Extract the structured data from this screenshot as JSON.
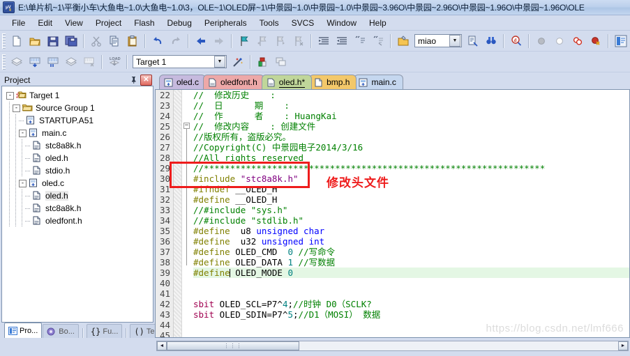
{
  "window": {
    "title": "E:\\单片机~1\\平衡小车\\大鱼电~1.0\\大鱼电~1.0\\3，OLE~1\\OLED屏~1\\中景园~1.0\\中景园~1.0\\中景园~3.96O\\中景园~2.96O\\中景园~1.96O\\中景园~1.96O\\OLE",
    "icon": "keil-uvision-icon"
  },
  "menu": {
    "items": [
      "File",
      "Edit",
      "View",
      "Project",
      "Flash",
      "Debug",
      "Peripherals",
      "Tools",
      "SVCS",
      "Window",
      "Help"
    ]
  },
  "toolbar_main": {
    "buttons": [
      {
        "name": "new-file-button",
        "icon": "new-file-icon"
      },
      {
        "name": "open-file-button",
        "icon": "open-folder-icon"
      },
      {
        "name": "save-button",
        "icon": "floppy-disk-icon"
      },
      {
        "name": "save-all-button",
        "icon": "save-all-icon"
      },
      {
        "name": "cut-button",
        "icon": "scissors-icon"
      },
      {
        "name": "copy-button",
        "icon": "copy-icon"
      },
      {
        "name": "paste-button",
        "icon": "paste-icon"
      },
      {
        "name": "undo-button",
        "icon": "undo-arrow-icon"
      },
      {
        "name": "redo-button",
        "icon": "redo-arrow-icon"
      },
      {
        "name": "navigate-back-button",
        "icon": "left-arrow-icon"
      },
      {
        "name": "navigate-forward-button",
        "icon": "right-arrow-icon"
      },
      {
        "name": "toggle-bookmark-button",
        "icon": "bookmark-flag-icon"
      },
      {
        "name": "previous-bookmark-button",
        "icon": "bookmark-prev-icon"
      },
      {
        "name": "next-bookmark-button",
        "icon": "bookmark-next-icon"
      },
      {
        "name": "clear-bookmarks-button",
        "icon": "bookmark-clear-icon"
      },
      {
        "name": "indent-button",
        "icon": "indent-icon"
      },
      {
        "name": "outdent-button",
        "icon": "outdent-icon"
      },
      {
        "name": "comment-button",
        "icon": "comment-lines-icon"
      },
      {
        "name": "uncomment-button",
        "icon": "uncomment-lines-icon"
      },
      {
        "name": "open-file-dialog-button",
        "icon": "open-document-icon"
      }
    ],
    "search_box": {
      "value": "miao",
      "placeholder": "",
      "name": "find-combo"
    },
    "after_search_buttons": [
      {
        "name": "find-in-files-button",
        "icon": "find-in-files-icon"
      },
      {
        "name": "incremental-find-button",
        "icon": "binoculars-icon"
      },
      {
        "name": "browse-symbols-button",
        "icon": "magnifier-d-icon"
      },
      {
        "name": "insert-breakpoint-button",
        "icon": "gray-dot-icon"
      },
      {
        "name": "kill-all-breakpoints-button",
        "icon": "white-dot-icon"
      },
      {
        "name": "disable-breakpoint-button",
        "icon": "red-rings-icon"
      },
      {
        "name": "remove-breakpoint-button",
        "icon": "red-dot-x-icon"
      },
      {
        "name": "project-window-button",
        "icon": "project-window-icon"
      }
    ]
  },
  "toolbar_build": {
    "buttons": [
      {
        "name": "translate-button",
        "icon": "translate-icon"
      },
      {
        "name": "build-button",
        "icon": "build-icon"
      },
      {
        "name": "rebuild-all-button",
        "icon": "rebuild-icon"
      },
      {
        "name": "batch-build-button",
        "icon": "batch-build-icon"
      },
      {
        "name": "stop-build-button",
        "icon": "stop-build-icon"
      },
      {
        "name": "download-button",
        "icon": "load-download-icon"
      }
    ],
    "target_select": {
      "value": "Target 1",
      "name": "target-select"
    },
    "after_target_buttons": [
      {
        "name": "options-for-target-button",
        "icon": "magic-wand-icon"
      },
      {
        "name": "manage-project-items-button",
        "icon": "manage-components-icon"
      },
      {
        "name": "multi-project-button",
        "icon": "multi-project-icon"
      }
    ]
  },
  "project_panel": {
    "title": "Project",
    "pin_icon": "pin-icon",
    "close_icon": "close-icon",
    "tree": [
      {
        "label": "Target 1",
        "depth": 0,
        "expander": "-",
        "icon": "target-icon",
        "selected": false
      },
      {
        "label": "Source Group 1",
        "depth": 1,
        "expander": "-",
        "icon": "folder-icon",
        "selected": false
      },
      {
        "label": "STARTUP.A51",
        "depth": 2,
        "expander": "",
        "icon": "asm-file-icon",
        "selected": false
      },
      {
        "label": "main.c",
        "depth": 2,
        "expander": "-",
        "icon": "c-file-icon",
        "selected": false
      },
      {
        "label": "stc8a8k.h",
        "depth": 3,
        "expander": "",
        "icon": "header-file-icon",
        "selected": false
      },
      {
        "label": "oled.h",
        "depth": 3,
        "expander": "",
        "icon": "header-file-icon",
        "selected": false
      },
      {
        "label": "stdio.h",
        "depth": 3,
        "expander": "",
        "icon": "header-file-icon",
        "selected": false
      },
      {
        "label": "oled.c",
        "depth": 2,
        "expander": "-",
        "icon": "c-file-icon",
        "selected": false
      },
      {
        "label": "oled.h",
        "depth": 3,
        "expander": "",
        "icon": "header-file-icon",
        "selected": true
      },
      {
        "label": "stc8a8k.h",
        "depth": 3,
        "expander": "",
        "icon": "header-file-icon",
        "selected": false
      },
      {
        "label": "oledfont.h",
        "depth": 3,
        "expander": "",
        "icon": "header-file-icon",
        "selected": false
      }
    ],
    "bottom_tabs": [
      {
        "label": "Pro...",
        "icon": "project-icon",
        "active": true
      },
      {
        "label": "Bo...",
        "icon": "books-icon",
        "active": false
      },
      {
        "label": "Fu...",
        "icon": "braces-icon",
        "active": false
      },
      {
        "label": "Te...",
        "icon": "templates-icon",
        "active": false
      }
    ]
  },
  "editor": {
    "tabs": [
      {
        "label": "oled.c",
        "icon": "c-file-icon",
        "modified": false,
        "active": false
      },
      {
        "label": "oledfont.h",
        "icon": "header-file-icon",
        "modified": false,
        "active": false
      },
      {
        "label": "oled.h*",
        "icon": "header-file-icon",
        "modified": true,
        "active": true
      },
      {
        "label": "bmp.h",
        "icon": "plain-file-icon",
        "modified": false,
        "active": false
      },
      {
        "label": "main.c",
        "icon": "c-file-icon",
        "modified": false,
        "active": false
      }
    ],
    "first_line_number": 22,
    "lines": [
      {
        "n": 22,
        "tokens": [
          {
            "t": "//  修改历史    :",
            "c": "cmt"
          }
        ]
      },
      {
        "n": 23,
        "tokens": [
          {
            "t": "//  日      期    :",
            "c": "cmt"
          }
        ]
      },
      {
        "n": 24,
        "tokens": [
          {
            "t": "//  作      者    : HuangKai",
            "c": "cmt"
          }
        ]
      },
      {
        "n": 25,
        "tokens": [
          {
            "t": "//  修改内容    : 创建文件",
            "c": "cmt"
          }
        ]
      },
      {
        "n": 26,
        "tokens": [
          {
            "t": "//版权所有，盗版必究。",
            "c": "cmt"
          }
        ]
      },
      {
        "n": 27,
        "tokens": [
          {
            "t": "//Copyright(C) 中景园电子2014/3/16",
            "c": "cmt"
          }
        ]
      },
      {
        "n": 28,
        "tokens": [
          {
            "t": "//All rights reserved",
            "c": "cmt"
          }
        ]
      },
      {
        "n": 29,
        "tokens": [
          {
            "t": "//*****************************************************************",
            "c": "cmt"
          }
        ]
      },
      {
        "n": 30,
        "tokens": [
          {
            "t": "#include ",
            "c": "kw"
          },
          {
            "t": "\"stc8a8k.h\"",
            "c": "str"
          }
        ]
      },
      {
        "n": 31,
        "tokens": [
          {
            "t": "#ifndef",
            "c": "kw"
          },
          {
            "t": " __OLED_H",
            "c": "plain"
          }
        ]
      },
      {
        "n": 32,
        "tokens": [
          {
            "t": "#define",
            "c": "kw"
          },
          {
            "t": " __OLED_H",
            "c": "plain"
          }
        ]
      },
      {
        "n": 33,
        "tokens": [
          {
            "t": "//#include \"sys.h\"",
            "c": "cmt"
          }
        ]
      },
      {
        "n": 34,
        "tokens": [
          {
            "t": "//#include \"stdlib.h\"",
            "c": "cmt"
          }
        ]
      },
      {
        "n": 35,
        "tokens": [
          {
            "t": "#define",
            "c": "kw"
          },
          {
            "t": "  u8 ",
            "c": "plain"
          },
          {
            "t": "unsigned char",
            "c": "kw2"
          }
        ]
      },
      {
        "n": 36,
        "tokens": [
          {
            "t": "#define",
            "c": "kw"
          },
          {
            "t": "  u32 ",
            "c": "plain"
          },
          {
            "t": "unsigned int",
            "c": "kw2"
          }
        ]
      },
      {
        "n": 37,
        "tokens": [
          {
            "t": "#define",
            "c": "kw"
          },
          {
            "t": " OLED_CMD  ",
            "c": "plain"
          },
          {
            "t": "0",
            "c": "num"
          },
          {
            "t": " ",
            "c": "plain"
          },
          {
            "t": "//写命令",
            "c": "cmt"
          }
        ]
      },
      {
        "n": 38,
        "tokens": [
          {
            "t": "#define",
            "c": "kw"
          },
          {
            "t": " OLED_DATA ",
            "c": "plain"
          },
          {
            "t": "1",
            "c": "num"
          },
          {
            "t": " ",
            "c": "plain"
          },
          {
            "t": "//写数据",
            "c": "cmt"
          }
        ]
      },
      {
        "n": 39,
        "highlight": true,
        "caret_after": 7,
        "tokens": [
          {
            "t": "#define",
            "c": "kw"
          },
          {
            "t": " OLED_MODE ",
            "c": "plain"
          },
          {
            "t": "0",
            "c": "num"
          }
        ]
      },
      {
        "n": 40,
        "tokens": []
      },
      {
        "n": 41,
        "tokens": []
      },
      {
        "n": 42,
        "tokens": [
          {
            "t": "sbit",
            "c": "sbit"
          },
          {
            "t": " OLED_SCL=P7^",
            "c": "plain"
          },
          {
            "t": "4",
            "c": "num"
          },
          {
            "t": ";",
            "c": "plain"
          },
          {
            "t": "//时钟 D0（SCLK?",
            "c": "cmt"
          }
        ]
      },
      {
        "n": 43,
        "tokens": [
          {
            "t": "sbit",
            "c": "sbit"
          },
          {
            "t": " OLED_SDIN=P7^",
            "c": "plain"
          },
          {
            "t": "5",
            "c": "num"
          },
          {
            "t": ";",
            "c": "plain"
          },
          {
            "t": "//D1（MOSI） 数据",
            "c": "cmt"
          }
        ]
      },
      {
        "n": 44,
        "tokens": []
      },
      {
        "n": 45,
        "tokens": []
      }
    ],
    "annotation": {
      "label": "修改头文件",
      "color": "#ee1c1c"
    }
  },
  "watermark": {
    "text": "https://blog.csdn.net/lmf666"
  },
  "scrollbars": {
    "left_arrow": "◄",
    "right_arrow": "►",
    "grip": "⋮⋮⋮"
  }
}
